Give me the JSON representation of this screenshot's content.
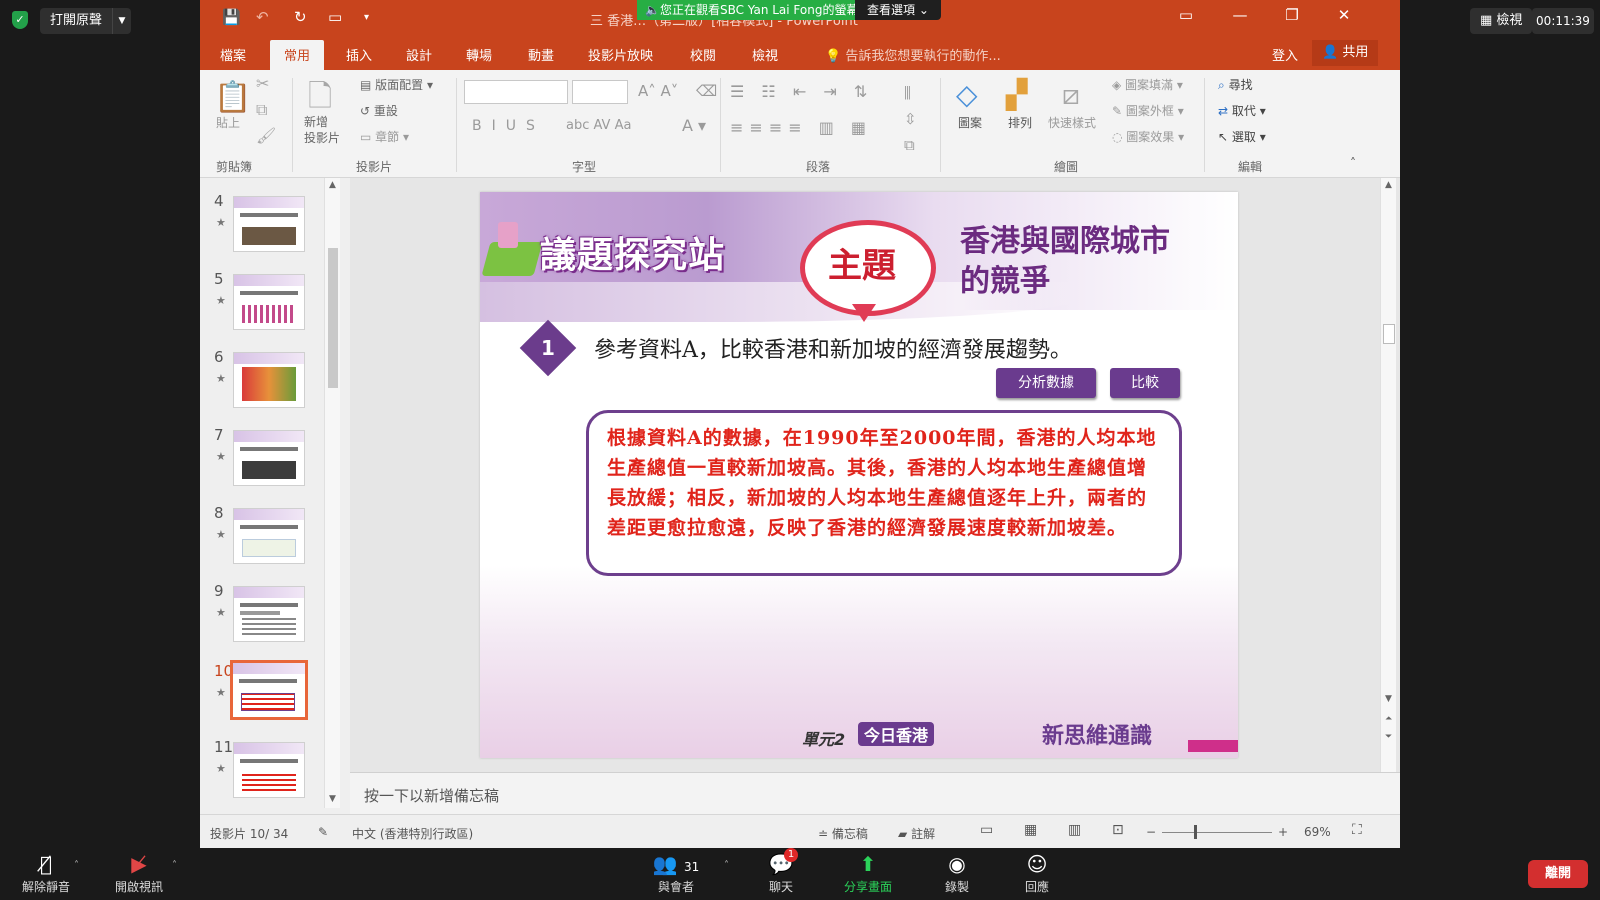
{
  "zoom_top": {
    "original_sound": "打開原聲",
    "view": "檢視",
    "timer": "00:11:39"
  },
  "ppt": {
    "share_banner": "您正在觀看SBC Yan Lai Fong的螢幕",
    "view_options": "查看選項",
    "window_title": "三 香港…（第二版）[相容模式] - PowerPoint",
    "tabs": [
      "檔案",
      "常用",
      "插入",
      "設計",
      "轉場",
      "動畫",
      "投影片放映",
      "校閱",
      "檢視"
    ],
    "active_tab": "常用",
    "tell_me": "告訴我您想要執行的動作...",
    "sign_in": "登入",
    "share": "共用",
    "ribbon": {
      "groups": [
        "剪貼簿",
        "投影片",
        "字型",
        "段落",
        "繪圖",
        "編輯"
      ],
      "paste": "貼上",
      "new_slide": "新增\n投影片",
      "layout": "版面配置",
      "reset": "重設",
      "section": "章節",
      "shapes": "圖案",
      "arrange": "排列",
      "quick_styles": "快速樣式",
      "shape_fill": "圖案填滿",
      "shape_outline": "圖案外框",
      "shape_effects": "圖案效果",
      "find": "尋找",
      "replace": "取代",
      "select": "選取"
    },
    "thumbnails": [
      {
        "num": "4"
      },
      {
        "num": "5"
      },
      {
        "num": "6"
      },
      {
        "num": "7"
      },
      {
        "num": "8"
      },
      {
        "num": "9"
      },
      {
        "num": "10"
      },
      {
        "num": "11"
      }
    ],
    "selected_slide": "10",
    "notes_placeholder": "按一下以新增備忘稿",
    "status": {
      "slide_info": "投影片 10/ 34",
      "language": "中文 (香港特別行政區)",
      "notes": "備忘稿",
      "comments": "註解",
      "zoom": "69%"
    }
  },
  "slide": {
    "logo": "議題探究站",
    "topic_badge": "主題",
    "topic_line1": "香港與國際城市",
    "topic_line2": "的競爭",
    "question_number": "1",
    "question": "參考資料A，比較香港和新加坡的經濟發展趨勢。",
    "button_analyze": "分析數據",
    "button_compare": "比較",
    "answer": "根據資料A的數據，在1990年至2000年間，香港的人均本地生產總值一直較新加坡高。其後，香港的人均本地生產總值增長放緩；相反，新加坡的人均本地生產總值逐年上升，兩者的差距更愈拉愈遠，反映了香港的經濟發展速度較新加坡差。",
    "unit_label": "單元2",
    "unit_name": "今日香港",
    "brand": "新思維通識"
  },
  "zoom_bottom": {
    "unmute": "解除靜音",
    "start_video": "開啟視訊",
    "participants": "與會者",
    "participants_count": "31",
    "chat": "聊天",
    "chat_badge": "1",
    "share_screen": "分享畫面",
    "record": "錄製",
    "reactions": "回應",
    "leave": "離開"
  },
  "colors": {
    "ppt_accent": "#c8441d",
    "slide_purple": "#6a3b8e",
    "answer_red": "#e0241b",
    "zoom_green": "#2bd35a",
    "leave_red": "#d32f2f"
  }
}
